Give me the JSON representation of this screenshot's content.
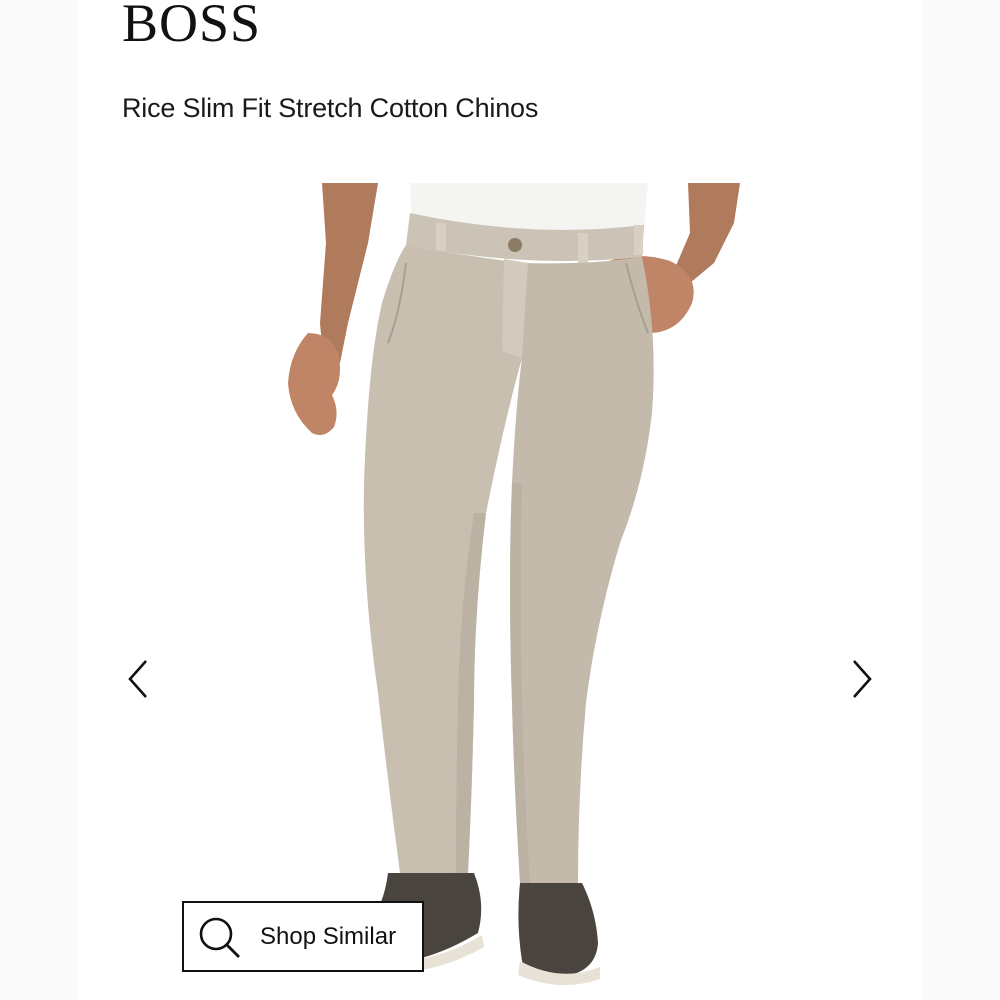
{
  "brand": "BOSS",
  "product": {
    "title": "Rice Slim Fit Stretch Cotton Chinos"
  },
  "gallery": {
    "prev_icon": "chevron-left-icon",
    "next_icon": "chevron-right-icon"
  },
  "shop_similar": {
    "label": "Shop Similar",
    "icon": "search-icon"
  },
  "colors": {
    "chino": "#c8bfb1",
    "text": "#111111",
    "background": "#ffffff"
  }
}
